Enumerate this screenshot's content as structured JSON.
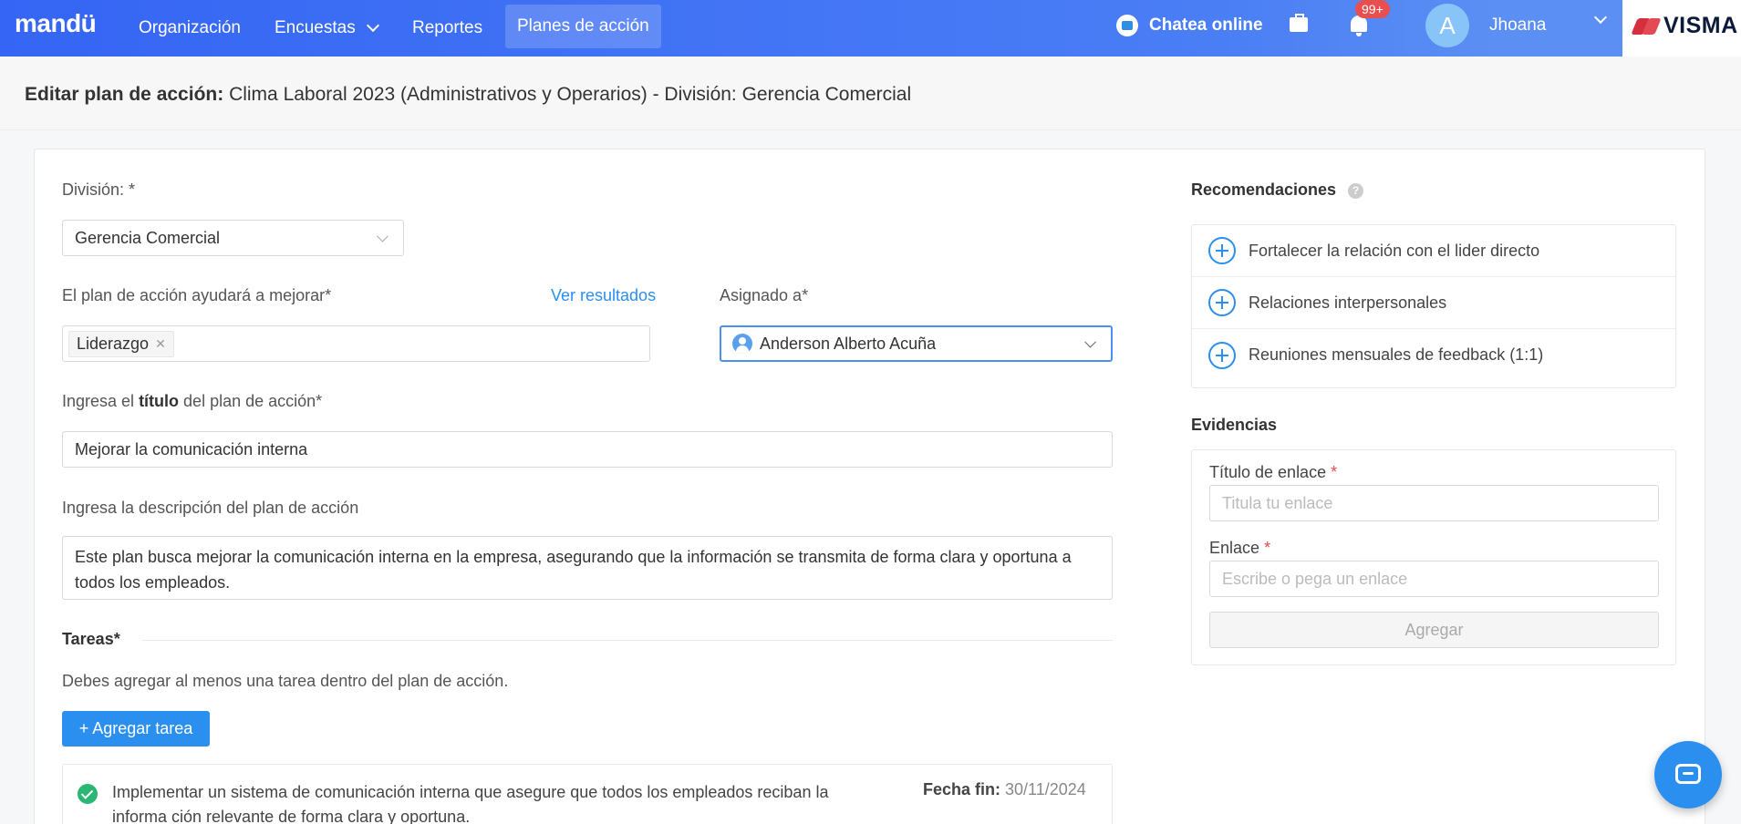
{
  "nav": {
    "logo": "mandü",
    "items": [
      {
        "label": "Organización"
      },
      {
        "label": "Encuestas"
      },
      {
        "label": "Reportes"
      },
      {
        "label": "Planes de acción"
      }
    ],
    "chat_online": "Chatea online",
    "notif_badge": "99+",
    "avatar_initial": "A",
    "user_name": "Jhoana",
    "brand": "VISMA"
  },
  "header": {
    "title_bold": "Editar plan de acción:",
    "title_rest": "Clima Laboral 2023 (Administrativos y Operarios) - División: Gerencia Comercial"
  },
  "form": {
    "division_label": "División: *",
    "division_value": "Gerencia Comercial",
    "improve_label": "El plan de acción ayudará a mejorar*",
    "see_results": "Ver resultados",
    "improve_tags": [
      "Liderazgo"
    ],
    "assigned_label": "Asignado a*",
    "assigned_value": "Anderson Alberto Acuña",
    "title_label_pre": "Ingresa el ",
    "title_label_bold": "título",
    "title_label_post": " del plan de acción*",
    "title_value": "Mejorar la comunicación interna",
    "desc_label": "Ingresa la descripción del plan de acción",
    "desc_value": "Este plan busca mejorar la comunicación interna en la empresa, asegurando que la información se transmita de forma clara y oportuna a todos los empleados.",
    "tasks_title": "Tareas*",
    "tasks_hint": "Debes agregar al menos una tarea dentro del plan de acción.",
    "add_task": "+ Agregar tarea",
    "task": {
      "text": "Implementar un sistema de comunicación interna que asegure que todos los empleados reciban la informa ción relevante de forma clara y oportuna.",
      "due_label": "Fecha fin:",
      "due_value": "30/11/2024"
    }
  },
  "recommendations": {
    "title": "Recomendaciones",
    "help": "?",
    "items": [
      "Fortalecer la relación con el lider directo",
      "Relaciones interpersonales",
      "Reuniones mensuales de feedback (1:1)"
    ]
  },
  "evidence": {
    "title": "Evidencias",
    "link_title_label": "Título de enlace",
    "link_title_placeholder": "Titula tu enlace",
    "link_label": "Enlace",
    "link_placeholder": "Escribe o pega un enlace",
    "required_mark": "*",
    "add_button": "Agregar"
  },
  "colors": {
    "primary": "#2b8ff0",
    "nav_start": "#3565f4",
    "success": "#2bb673",
    "badge": "#ea4f4f"
  }
}
